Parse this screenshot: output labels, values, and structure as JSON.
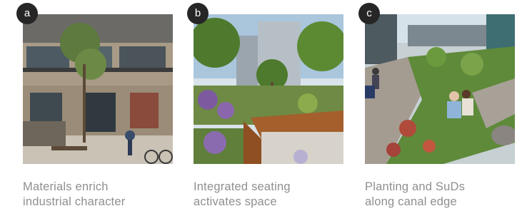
{
  "cards": [
    {
      "label": "a",
      "caption_line1": "Materials enrich",
      "caption_line2": "industrial character"
    },
    {
      "label": "b",
      "caption_line1": "Integrated seating",
      "caption_line2": "activates space"
    },
    {
      "label": "c",
      "caption_line1": "Planting and SuDs",
      "caption_line2": "along canal edge"
    }
  ],
  "colors": {
    "badge": "#262626",
    "caption": "#8f8f8f",
    "background": "#ffffff"
  }
}
